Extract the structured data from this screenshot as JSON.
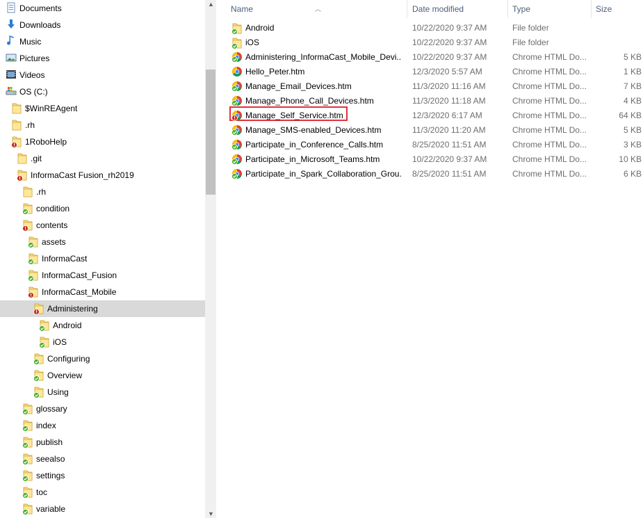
{
  "nav": {
    "items": [
      {
        "label": "Documents",
        "icon": "documents-icon",
        "level": 0
      },
      {
        "label": "Downloads",
        "icon": "downloads-icon",
        "level": 0
      },
      {
        "label": "Music",
        "icon": "music-icon",
        "level": 0
      },
      {
        "label": "Pictures",
        "icon": "pictures-icon",
        "level": 0
      },
      {
        "label": "Videos",
        "icon": "videos-icon",
        "level": 0
      },
      {
        "label": "OS (C:)",
        "icon": "drive-icon",
        "level": 0
      },
      {
        "label": "$WinREAgent",
        "icon": "folder-icon",
        "level": 1
      },
      {
        "label": ".rh",
        "icon": "folder-icon",
        "level": 1
      },
      {
        "label": "1RoboHelp",
        "icon": "folder-conflict-icon",
        "level": 1
      },
      {
        "label": ".git",
        "icon": "folder-icon",
        "level": 2
      },
      {
        "label": "InformaCast Fusion_rh2019",
        "icon": "folder-conflict-icon",
        "level": 2
      },
      {
        "label": ".rh",
        "icon": "folder-icon",
        "level": 3
      },
      {
        "label": "condition",
        "icon": "folder-synced-icon",
        "level": 3
      },
      {
        "label": "contents",
        "icon": "folder-conflict-icon",
        "level": 3
      },
      {
        "label": "assets",
        "icon": "folder-synced-icon",
        "level": 4
      },
      {
        "label": "InformaCast",
        "icon": "folder-synced-icon",
        "level": 4
      },
      {
        "label": "InformaCast_Fusion",
        "icon": "folder-synced-icon",
        "level": 4
      },
      {
        "label": "InformaCast_Mobile",
        "icon": "folder-conflict-icon",
        "level": 4
      },
      {
        "label": "Administering",
        "icon": "folder-conflict-icon",
        "level": 5,
        "selected": true
      },
      {
        "label": "Android",
        "icon": "folder-synced-icon",
        "level": 6
      },
      {
        "label": "iOS",
        "icon": "folder-synced-icon",
        "level": 6
      },
      {
        "label": "Configuring",
        "icon": "folder-synced-icon",
        "level": 5
      },
      {
        "label": "Overview",
        "icon": "folder-synced-icon",
        "level": 5
      },
      {
        "label": "Using",
        "icon": "folder-synced-icon",
        "level": 5
      },
      {
        "label": "glossary",
        "icon": "folder-synced-icon",
        "level": 3
      },
      {
        "label": "index",
        "icon": "folder-synced-icon",
        "level": 3
      },
      {
        "label": "publish",
        "icon": "folder-synced-icon",
        "level": 3
      },
      {
        "label": "seealso",
        "icon": "folder-synced-icon",
        "level": 3
      },
      {
        "label": "settings",
        "icon": "folder-synced-icon",
        "level": 3
      },
      {
        "label": "toc",
        "icon": "folder-synced-icon",
        "level": 3
      },
      {
        "label": "variable",
        "icon": "folder-synced-icon",
        "level": 3
      }
    ]
  },
  "list": {
    "headers": {
      "name": "Name",
      "date": "Date modified",
      "type": "Type",
      "size": "Size"
    },
    "rows": [
      {
        "name": "Android",
        "date": "10/22/2020 9:37 AM",
        "type": "File folder",
        "size": "",
        "icon": "folder-synced-icon"
      },
      {
        "name": "iOS",
        "date": "10/22/2020 9:37 AM",
        "type": "File folder",
        "size": "",
        "icon": "folder-synced-icon"
      },
      {
        "name": "Administering_InformaCast_Mobile_Devi...",
        "date": "10/22/2020 9:37 AM",
        "type": "Chrome HTML Do...",
        "size": "5 KB",
        "icon": "chrome-synced-icon"
      },
      {
        "name": "Hello_Peter.htm",
        "date": "12/3/2020 5:57 AM",
        "type": "Chrome HTML Do...",
        "size": "1 KB",
        "icon": "chrome-icon"
      },
      {
        "name": "Manage_Email_Devices.htm",
        "date": "11/3/2020 11:16 AM",
        "type": "Chrome HTML Do...",
        "size": "7 KB",
        "icon": "chrome-synced-icon"
      },
      {
        "name": "Manage_Phone_Call_Devices.htm",
        "date": "11/3/2020 11:18 AM",
        "type": "Chrome HTML Do...",
        "size": "4 KB",
        "icon": "chrome-synced-icon"
      },
      {
        "name": "Manage_Self_Service.htm",
        "date": "12/3/2020 6:17 AM",
        "type": "Chrome HTML Do...",
        "size": "64 KB",
        "icon": "chrome-conflict-icon",
        "highlighted": true
      },
      {
        "name": "Manage_SMS-enabled_Devices.htm",
        "date": "11/3/2020 11:20 AM",
        "type": "Chrome HTML Do...",
        "size": "5 KB",
        "icon": "chrome-synced-icon"
      },
      {
        "name": "Participate_in_Conference_Calls.htm",
        "date": "8/25/2020 11:51 AM",
        "type": "Chrome HTML Do...",
        "size": "3 KB",
        "icon": "chrome-synced-icon"
      },
      {
        "name": "Participate_in_Microsoft_Teams.htm",
        "date": "10/22/2020 9:37 AM",
        "type": "Chrome HTML Do...",
        "size": "10 KB",
        "icon": "chrome-synced-icon"
      },
      {
        "name": "Participate_in_Spark_Collaboration_Grou...",
        "date": "8/25/2020 11:51 AM",
        "type": "Chrome HTML Do...",
        "size": "6 KB",
        "icon": "chrome-synced-icon"
      }
    ]
  },
  "colors": {
    "selected_bg": "#d9d9d9",
    "highlight_border": "#e0313c",
    "header_text": "#4c607a",
    "muted_text": "#6d6d6d"
  }
}
